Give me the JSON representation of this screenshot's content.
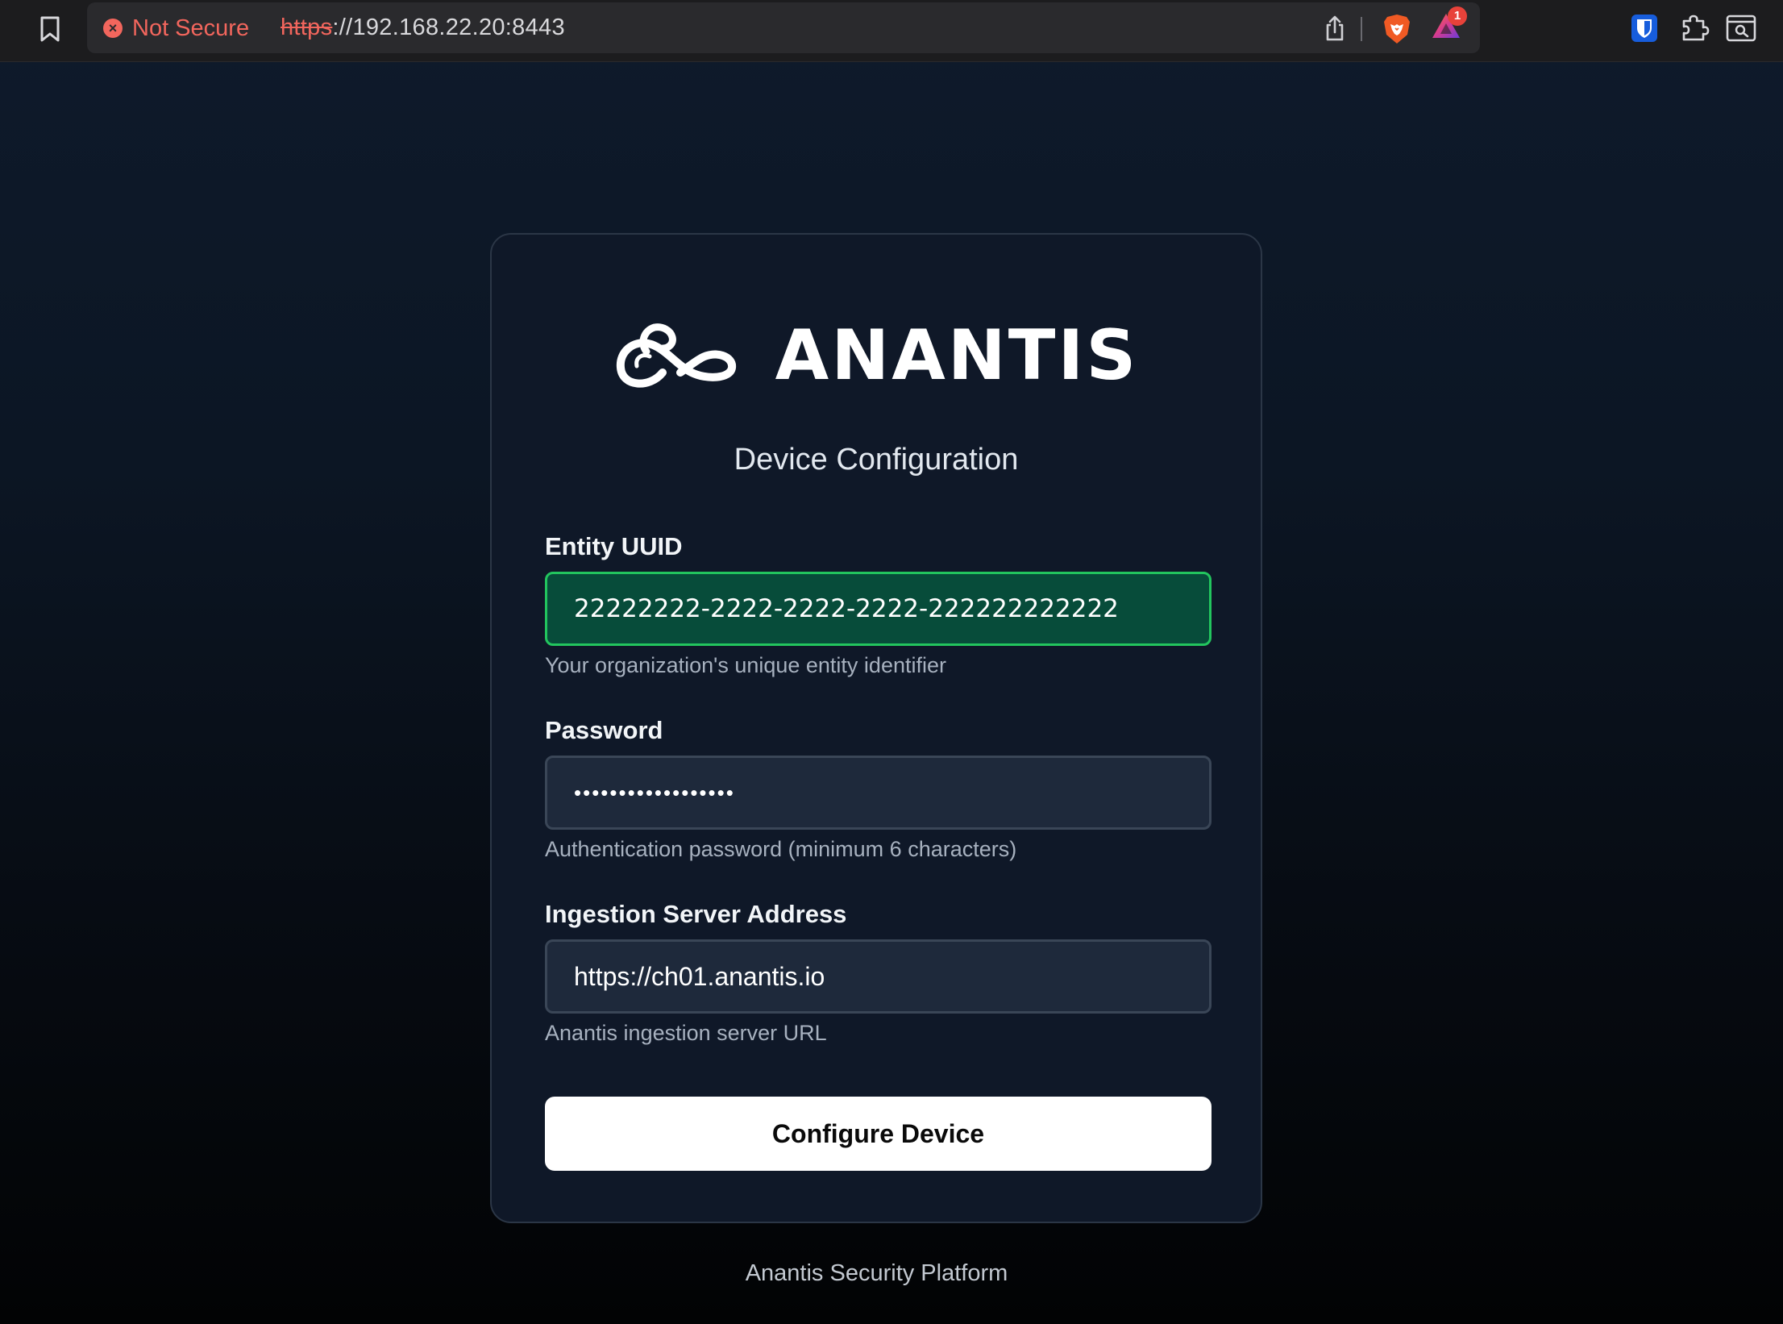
{
  "browser": {
    "security_label": "Not Secure",
    "url_scheme": "https",
    "url_rest": "://192.168.22.20:8443",
    "rewards_badge_count": "1",
    "icons": [
      "bookmark-icon",
      "close-circle-icon",
      "share-icon",
      "brave-shield-icon",
      "rewards-triangle-icon",
      "bitwarden-shield-icon",
      "puzzle-piece-icon",
      "reader-mode-icon"
    ]
  },
  "brand": {
    "name": "ANANTIS",
    "logo_icon": "serpent-infinity-logo"
  },
  "form": {
    "title": "Device Configuration",
    "fields": [
      {
        "label": "Entity UUID",
        "value": "22222222-2222-2222-2222-222222222222",
        "help": "Your organization's unique entity identifier",
        "state": "valid"
      },
      {
        "label": "Password",
        "value": "••••••••••••••••••",
        "help": "Authentication password (minimum 6 characters)"
      },
      {
        "label": "Ingestion Server Address",
        "value": "https://ch01.anantis.io",
        "help": "Anantis ingestion server URL"
      }
    ],
    "submit_label": "Configure Device"
  },
  "footer": {
    "text": "Anantis Security Platform"
  },
  "colors": {
    "background_top": "#0e1a2b",
    "card": "#0f1828",
    "valid_field_bg": "#074c3a",
    "valid_field_border": "#22c55e",
    "insecure_red": "#f2665d"
  }
}
